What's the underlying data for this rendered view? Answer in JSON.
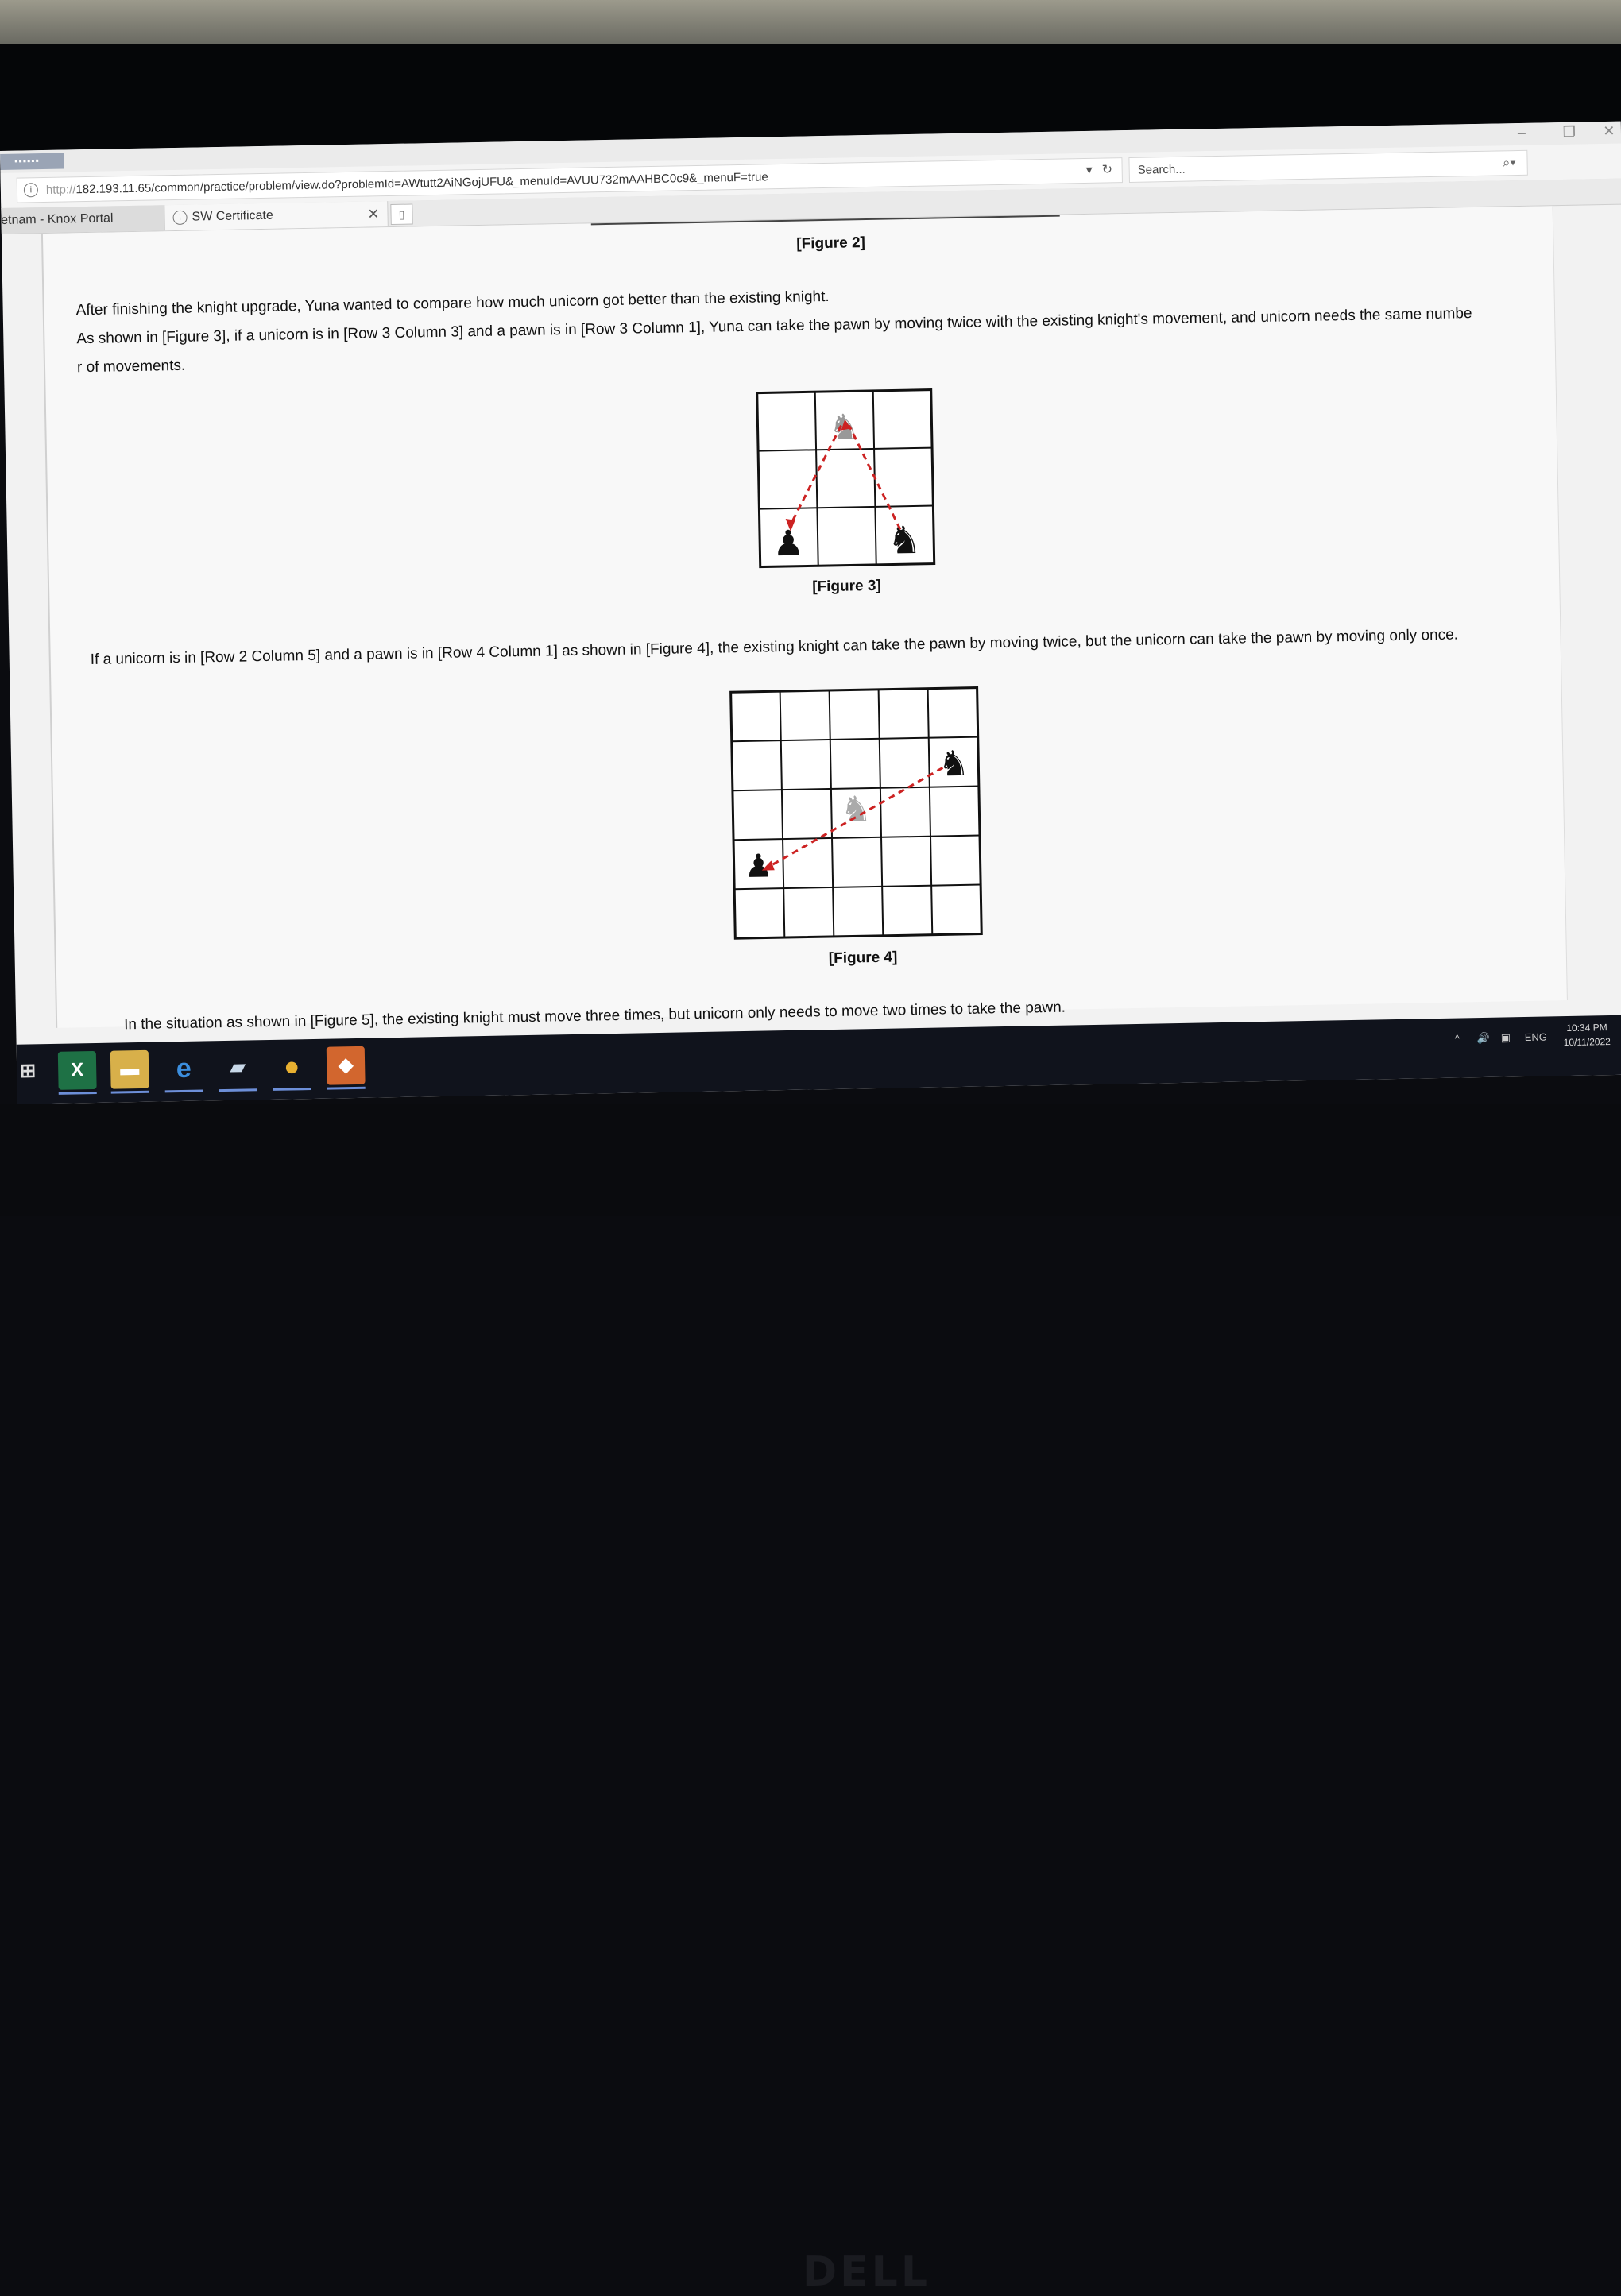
{
  "browser": {
    "url_proto": "http://",
    "url_rest": "182.193.11.65/common/practice/problem/view.do?problemId=AWtutt2AiNGojUFU&_menuId=AVUU732mAAHBC0c9&_menuF=true",
    "search_placeholder": "Search...",
    "tabs": [
      {
        "label": "ietnam - Knox Portal"
      },
      {
        "label": "SW Certificate"
      }
    ]
  },
  "problem": {
    "figure2_caption": "[Figure 2]",
    "para1_line1": "After finishing the knight upgrade, Yuna wanted to compare how much unicorn got better than the existing knight.",
    "para1_line2": "As shown in [Figure 3], if a unicorn is in [Row 3 Column 3] and a pawn is in [Row 3 Column 1], Yuna can take the pawn by moving twice with the existing knight's movement, and unicorn needs the same numbe",
    "para1_line3": "r of movements.",
    "figure3_caption": "[Figure 3]",
    "para2": "If a unicorn is in [Row 2 Column 5] and a pawn is in [Row 4 Column 1] as shown in [Figure 4], the existing knight can take the pawn by moving twice, but the unicorn can take the pawn by moving only once.",
    "figure4_caption": "[Figure 4]",
    "para3": "In the situation as shown in [Figure 5], the existing knight must move three times, but unicorn only needs to move two times to take the pawn."
  },
  "taskbar": {
    "apps": [
      {
        "name": "excel",
        "glyph": "X"
      },
      {
        "name": "file-explorer",
        "glyph": "▬"
      },
      {
        "name": "internet-explorer",
        "glyph": "e"
      },
      {
        "name": "app",
        "glyph": "▰"
      },
      {
        "name": "chrome",
        "glyph": "●"
      },
      {
        "name": "app-blue",
        "glyph": "◆"
      }
    ],
    "language": "ENG",
    "time": "10:34 PM",
    "date": "10/11/2022"
  },
  "colors": {
    "arrow": "#cc2222",
    "page_bg": "#f8f8f8",
    "taskbar_bg": "#10131c"
  },
  "monitor_brand": "DELL"
}
